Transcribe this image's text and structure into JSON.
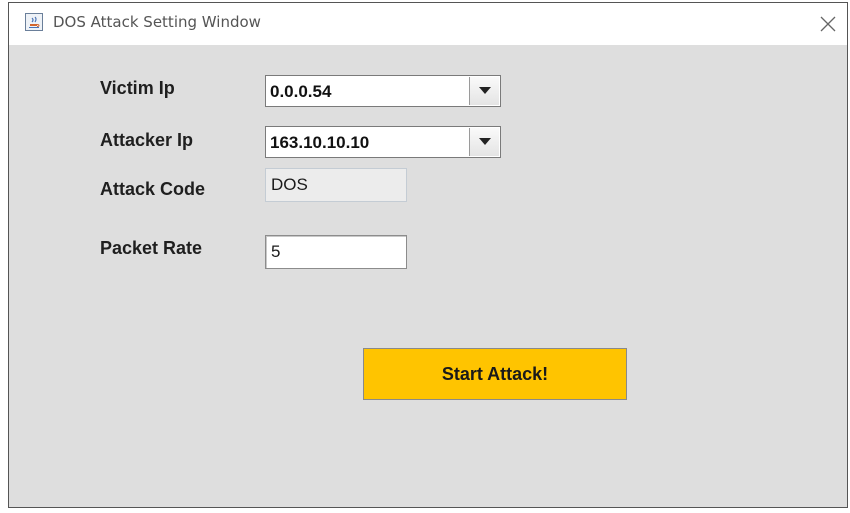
{
  "window": {
    "title": "DOS Attack Setting Window",
    "icon": "java-app-icon",
    "close_icon": "close-icon"
  },
  "form": {
    "victim_ip": {
      "label": "Victim Ip",
      "selected": "0.0.0.54"
    },
    "attacker_ip": {
      "label": "Attacker Ip",
      "selected": "163.10.10.10"
    },
    "attack_code": {
      "label": "Attack Code",
      "value": "DOS"
    },
    "packet_rate": {
      "label": "Packet Rate",
      "value": "5"
    },
    "start_button": {
      "label": "Start Attack!"
    }
  },
  "colors": {
    "window_background": "#dedede",
    "titlebar_background": "#ffffff",
    "start_button": "#ffc400"
  }
}
